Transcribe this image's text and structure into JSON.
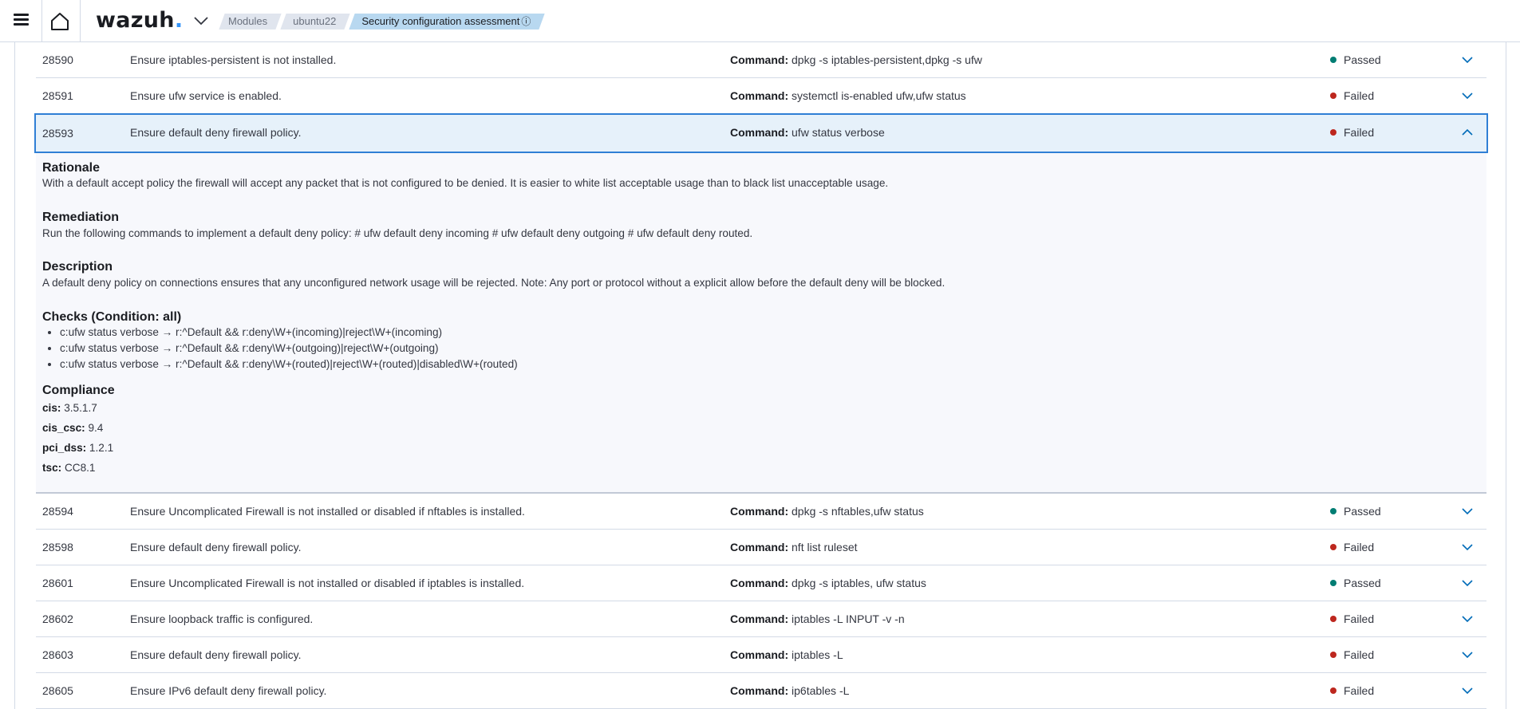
{
  "header": {
    "logo_text": "wazuh",
    "logo_dot": ".",
    "breadcrumbs": [
      {
        "label": "Modules"
      },
      {
        "label": "ubuntu22"
      },
      {
        "label": "Security configuration assessment"
      }
    ],
    "info_glyph": "ⓘ"
  },
  "colors": {
    "passed": "#017d73",
    "failed": "#bd271e",
    "accent": "#2f7fd5"
  },
  "rows_before": [
    {
      "id": "28590",
      "title": "Ensure iptables-persistent is not installed.",
      "command_label": "Command:",
      "command": "dpkg -s iptables-persistent,dpkg -s ufw",
      "status": "Passed"
    },
    {
      "id": "28591",
      "title": "Ensure ufw service is enabled.",
      "command_label": "Command:",
      "command": "systemctl is-enabled ufw,ufw status",
      "status": "Failed"
    }
  ],
  "selected_row": {
    "id": "28593",
    "title": "Ensure default deny firewall policy.",
    "command_label": "Command:",
    "command": "ufw status verbose",
    "status": "Failed"
  },
  "detail": {
    "rationale_heading": "Rationale",
    "rationale": "With a default accept policy the firewall will accept any packet that is not configured to be denied. It is easier to white list acceptable usage than to black list unacceptable usage.",
    "remediation_heading": "Remediation",
    "remediation": "Run the following commands to implement a default deny policy: # ufw default deny incoming # ufw default deny outgoing # ufw default deny routed.",
    "description_heading": "Description",
    "description": "A default deny policy on connections ensures that any unconfigured network usage will be rejected. Note: Any port or protocol without a explicit allow before the default deny will be blocked.",
    "checks_heading": "Checks (Condition: all)",
    "checks": [
      "c:ufw status verbose → r:^Default && r:deny\\W+(incoming)|reject\\W+(incoming)",
      "c:ufw status verbose → r:^Default && r:deny\\W+(outgoing)|reject\\W+(outgoing)",
      "c:ufw status verbose → r:^Default && r:deny\\W+(routed)|reject\\W+(routed)|disabled\\W+(routed)"
    ],
    "compliance_heading": "Compliance",
    "compliance": [
      {
        "key": "cis:",
        "value": "3.5.1.7"
      },
      {
        "key": "cis_csc:",
        "value": "9.4"
      },
      {
        "key": "pci_dss:",
        "value": "1.2.1"
      },
      {
        "key": "tsc:",
        "value": "CC8.1"
      }
    ]
  },
  "rows_after": [
    {
      "id": "28594",
      "title": "Ensure Uncomplicated Firewall is not installed or disabled if nftables is installed.",
      "command_label": "Command:",
      "command": "dpkg -s nftables,ufw status",
      "status": "Passed"
    },
    {
      "id": "28598",
      "title": "Ensure default deny firewall policy.",
      "command_label": "Command:",
      "command": "nft list ruleset",
      "status": "Failed"
    },
    {
      "id": "28601",
      "title": "Ensure Uncomplicated Firewall is not installed or disabled if iptables is installed.",
      "command_label": "Command:",
      "command": "dpkg -s iptables, ufw status",
      "status": "Passed"
    },
    {
      "id": "28602",
      "title": "Ensure loopback traffic is configured.",
      "command_label": "Command:",
      "command": "iptables -L INPUT -v -n",
      "status": "Failed"
    },
    {
      "id": "28603",
      "title": "Ensure default deny firewall policy.",
      "command_label": "Command:",
      "command": "iptables -L",
      "status": "Failed"
    },
    {
      "id": "28605",
      "title": "Ensure IPv6 default deny firewall policy.",
      "command_label": "Command:",
      "command": "ip6tables -L",
      "status": "Failed"
    }
  ]
}
